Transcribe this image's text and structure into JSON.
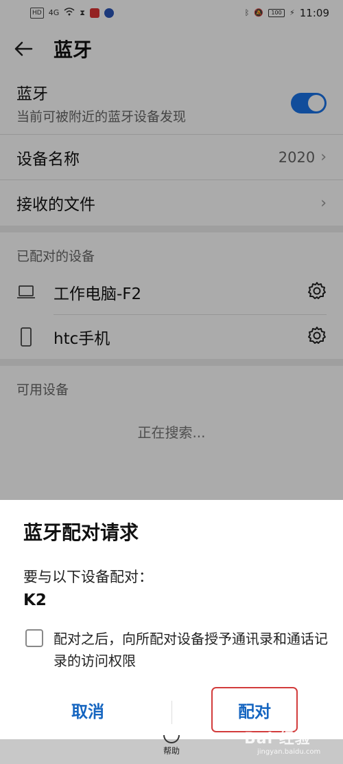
{
  "statusbar": {
    "left_icons": [
      "HD",
      "4G",
      "wifi-icon",
      "hourglass-icon"
    ],
    "time": "11:09",
    "battery": "100"
  },
  "header": {
    "title": "蓝牙"
  },
  "bluetooth": {
    "label": "蓝牙",
    "subtitle": "当前可被附近的蓝牙设备发现",
    "enabled": true
  },
  "device_name": {
    "label": "设备名称",
    "value": "2020"
  },
  "received_files": {
    "label": "接收的文件"
  },
  "paired": {
    "heading": "已配对的设备",
    "devices": [
      {
        "name": "工作电脑-F2",
        "icon": "laptop-icon"
      },
      {
        "name": "htc手机",
        "icon": "phone-icon"
      }
    ]
  },
  "available": {
    "heading": "可用设备",
    "status": "正在搜索..."
  },
  "dialog": {
    "title": "蓝牙配对请求",
    "message": "要与以下设备配对：",
    "device": "K2",
    "checkbox_label": "配对之后，向所配对设备授予通讯录和通话记录的访问权限",
    "checked": false,
    "cancel_label": "取消",
    "pair_label": "配对"
  },
  "bottom": {
    "help_label": "帮助"
  },
  "watermark": {
    "text": "Bai  经验",
    "sub": "jingyan.baidu.com"
  },
  "colors": {
    "accent": "#1a73e8",
    "button_text": "#1565c0",
    "highlight": "#d23b3b"
  }
}
